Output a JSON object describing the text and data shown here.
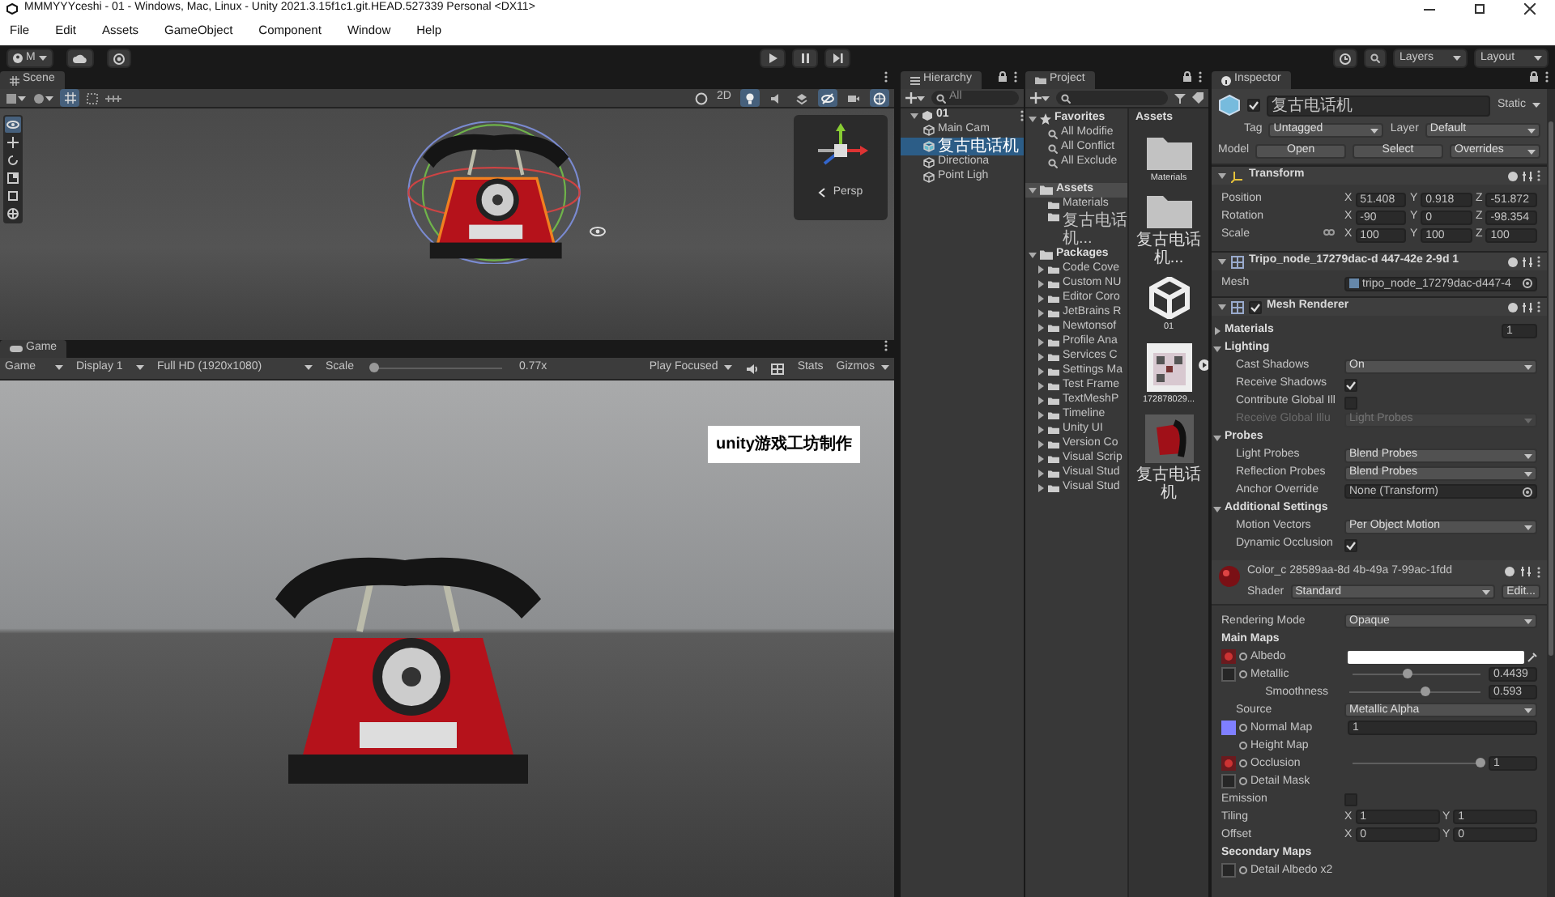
{
  "window": {
    "title": "MMMYYYceshi - 01 - Windows, Mac, Linux - Unity 2021.3.15f1c1.git.HEAD.527339 Personal <DX11>"
  },
  "menu": [
    "File",
    "Edit",
    "Assets",
    "GameObject",
    "Component",
    "Window",
    "Help"
  ],
  "toolbar": {
    "account": "M",
    "layers": "Layers",
    "layout": "Layout"
  },
  "scene": {
    "tab": "Scene",
    "mode_2d": "2D",
    "gizmo_label": "Persp",
    "toggles": [
      {
        "kind": "lighting",
        "on": true
      },
      {
        "kind": "audio",
        "on": false
      },
      {
        "kind": "effects",
        "on": false
      },
      {
        "kind": "visibility",
        "on": true
      },
      {
        "kind": "camera",
        "on": false
      },
      {
        "kind": "gizmos",
        "on": true
      }
    ],
    "tools": [
      {
        "kind": "view",
        "selected": true
      },
      {
        "kind": "move",
        "selected": false
      },
      {
        "kind": "rotate",
        "selected": false
      },
      {
        "kind": "scale",
        "selected": false
      },
      {
        "kind": "rect",
        "selected": false
      },
      {
        "kind": "transform",
        "selected": false
      }
    ]
  },
  "game": {
    "tab": "Game",
    "view": "Game",
    "display": "Display 1",
    "resolution": "Full HD (1920x1080)",
    "scale_label": "Scale",
    "scale": {
      "level": 0.02
    },
    "scale_value": "0.77x",
    "play_mode": "Play Focused",
    "stats": "Stats",
    "gizmos": "Gizmos",
    "overlay_label": "unity游戏工坊制作"
  },
  "hierarchy": {
    "tab": "Hierarchy",
    "search": "All",
    "scene": "01",
    "items": [
      {
        "name": "Main Cam",
        "selected": false
      },
      {
        "name": "复古电话机",
        "selected": true
      },
      {
        "name": "Directiona",
        "selected": false
      },
      {
        "name": "Point Ligh",
        "selected": false
      }
    ]
  },
  "project": {
    "tab": "Project",
    "sections": [
      {
        "label": "Favorites",
        "kind": "favorites",
        "selected": false,
        "children": [
          {
            "label": "All Modifie"
          },
          {
            "label": "All Conflict"
          },
          {
            "label": "All Exclude"
          }
        ]
      },
      {
        "label": "Assets",
        "kind": "folder",
        "selected": true,
        "children": [
          {
            "label": "Materials"
          },
          {
            "label": "复古电话机..."
          }
        ]
      },
      {
        "label": "Packages",
        "kind": "folder",
        "selected": false,
        "children": [
          {
            "label": "Code Cove"
          },
          {
            "label": "Custom NU"
          },
          {
            "label": "Editor Coro"
          },
          {
            "label": "JetBrains R"
          },
          {
            "label": "Newtonsof"
          },
          {
            "label": "Profile Ana"
          },
          {
            "label": "Services C"
          },
          {
            "label": "Settings Ma"
          },
          {
            "label": "Test Frame"
          },
          {
            "label": "TextMeshP"
          },
          {
            "label": "Timeline"
          },
          {
            "label": "Unity UI"
          },
          {
            "label": "Version Co"
          },
          {
            "label": "Visual Scrip"
          },
          {
            "label": "Visual Stud"
          },
          {
            "label": "Visual Stud"
          }
        ]
      }
    ],
    "grid_title": "Assets",
    "assets": [
      {
        "label": "Materials",
        "kind": "folder"
      },
      {
        "label": "复古电话机...",
        "kind": "folder"
      },
      {
        "label": "01",
        "kind": "scene"
      },
      {
        "label": "172878029...",
        "kind": "image"
      },
      {
        "label": "复古电话机",
        "kind": "model"
      }
    ]
  },
  "inspector": {
    "tab": "Inspector",
    "object": {
      "name": "复古电话机",
      "active": true,
      "static": "Static",
      "tag_label": "Tag",
      "tag": "Untagged",
      "layer_label": "Layer",
      "layer": "Default",
      "model_label": "Model",
      "open": "Open",
      "select": "Select",
      "overrides": "Overrides"
    },
    "transform": {
      "title": "Transform",
      "rows": [
        {
          "kind": "vector",
          "label": "Position",
          "fields": [
            {
              "axis": "X",
              "value": "51.408"
            },
            {
              "axis": "Y",
              "value": "0.918"
            },
            {
              "axis": "Z",
              "value": "-51.872"
            }
          ]
        },
        {
          "kind": "vector",
          "label": "Rotation",
          "fields": [
            {
              "axis": "X",
              "value": "-90"
            },
            {
              "axis": "Y",
              "value": "0"
            },
            {
              "axis": "Z",
              "value": "-98.354"
            }
          ]
        },
        {
          "kind": "linked_vector",
          "label": "Scale",
          "fields": [
            {
              "axis": "X",
              "value": "100"
            },
            {
              "axis": "Y",
              "value": "100"
            },
            {
              "axis": "Z",
              "value": "100"
            }
          ]
        }
      ]
    },
    "mesh_filter": {
      "title": "Tripo_node_17279dac-d 447-42e 2-9d 1",
      "mesh_label": "Mesh",
      "mesh": "tripo_node_17279dac-d447-4"
    },
    "mesh_renderer": {
      "title": "Mesh Renderer",
      "enabled": true,
      "rows": [
        {
          "kind": "section",
          "label": "Materials",
          "expanded": false,
          "value": "1"
        },
        {
          "kind": "section",
          "label": "Lighting",
          "expanded": true,
          "children": [
            {
              "kind": "dropdown",
              "label": "Cast Shadows",
              "value": "On",
              "disabled": false
            },
            {
              "kind": "check",
              "label": "Receive Shadows",
              "checked": true
            },
            {
              "kind": "check",
              "label": "Contribute Global Ill",
              "checked": false
            },
            {
              "kind": "dropdown",
              "label": "Receive Global Illu",
              "value": "Light Probes",
              "disabled": true
            }
          ]
        },
        {
          "kind": "section",
          "label": "Probes",
          "expanded": true,
          "children": [
            {
              "kind": "dropdown",
              "label": "Light Probes",
              "value": "Blend Probes",
              "disabled": false
            },
            {
              "kind": "dropdown",
              "label": "Reflection Probes",
              "value": "Blend Probes",
              "disabled": false
            },
            {
              "kind": "object",
              "label": "Anchor Override",
              "value": "None (Transform)"
            }
          ]
        },
        {
          "kind": "section",
          "label": "Additional Settings",
          "expanded": true,
          "children": [
            {
              "kind": "dropdown",
              "label": "Motion Vectors",
              "value": "Per Object Motion",
              "disabled": false
            },
            {
              "kind": "check",
              "label": "Dynamic Occlusion",
              "checked": true
            }
          ]
        }
      ]
    },
    "material": {
      "name": "Color_c 28589aa-8d 4b-49a 7-99ac-1fdd",
      "shader_label": "Shader",
      "shader": "Standard",
      "edit": "Edit...",
      "rows": [
        {
          "kind": "dropdown",
          "label": "Rendering Mode",
          "value": "Opaque",
          "disabled": false
        },
        {
          "kind": "header",
          "label": "Main Maps",
          "children": [
            {
              "kind": "map",
              "label": "Albedo",
              "thumbnail": {
                "kind": "texture"
              },
              "color": "#ffffff"
            },
            {
              "kind": "map",
              "label": "Metallic",
              "thumbnail": {
                "kind": "none"
              },
              "level": 0.43,
              "value": "0.4439",
              "children": [
                {
                  "kind": "slider",
                  "label": "Smoothness",
                  "level": 0.58,
                  "value": "0.593"
                },
                {
                  "kind": "dropdown",
                  "label": "Source",
                  "value": "Metallic Alpha",
                  "disabled": false
                }
              ]
            },
            {
              "kind": "map",
              "label": "Normal Map",
              "thumbnail": {
                "kind": "normal"
              },
              "value": "1"
            },
            {
              "kind": "map",
              "label": "Height Map"
            },
            {
              "kind": "map",
              "label": "Occlusion",
              "thumbnail": {
                "kind": "texture"
              },
              "level": 1,
              "value": "1"
            },
            {
              "kind": "map",
              "label": "Detail Mask",
              "thumbnail": {
                "kind": "none"
              }
            },
            {
              "kind": "check",
              "label": "Emission",
              "checked": false
            },
            {
              "kind": "vector",
              "label": "Tiling",
              "fields": [
                {
                  "axis": "X",
                  "value": "1"
                },
                {
                  "axis": "Y",
                  "value": "1"
                }
              ]
            },
            {
              "kind": "vector",
              "label": "Offset",
              "fields": [
                {
                  "axis": "X",
                  "value": "0"
                },
                {
                  "axis": "Y",
                  "value": "0"
                }
              ]
            }
          ]
        },
        {
          "kind": "header",
          "label": "Secondary Maps",
          "children": [
            {
              "kind": "map",
              "label": "Detail Albedo x2",
              "thumbnail": {
                "kind": "none"
              }
            }
          ]
        }
      ]
    }
  }
}
